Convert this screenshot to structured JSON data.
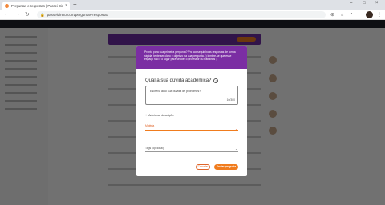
{
  "browser": {
    "tab_title": "Perguntas e respostas | Passei Direto",
    "url": "passeidireto.com/perguntas-respostas"
  },
  "modal": {
    "header_text": "Pronto para sua primeira pergunta? Pra conseguir boas respostas de forma rápida, tente ser claro e objetivo na sua pergunta. :) lembre-se que esse espaço não é o lugar para vender o professor ou trabalhos ;)",
    "question_label": "Qual a sua dúvida acadêmica?",
    "help_icon": "?",
    "textarea_value": "Escreva aqui sua dúvida de pronomes?",
    "counter": "10/300",
    "add_description": "Adicionar descrição",
    "subject_label": "Matéria",
    "tags_placeholder": "Tags (opcional)",
    "cancel_label": "Cancelar",
    "submit_label": "Enviar pergunta"
  },
  "colors": {
    "brand_purple": "#7b2ea3",
    "accent_orange": "#f07c1e"
  }
}
